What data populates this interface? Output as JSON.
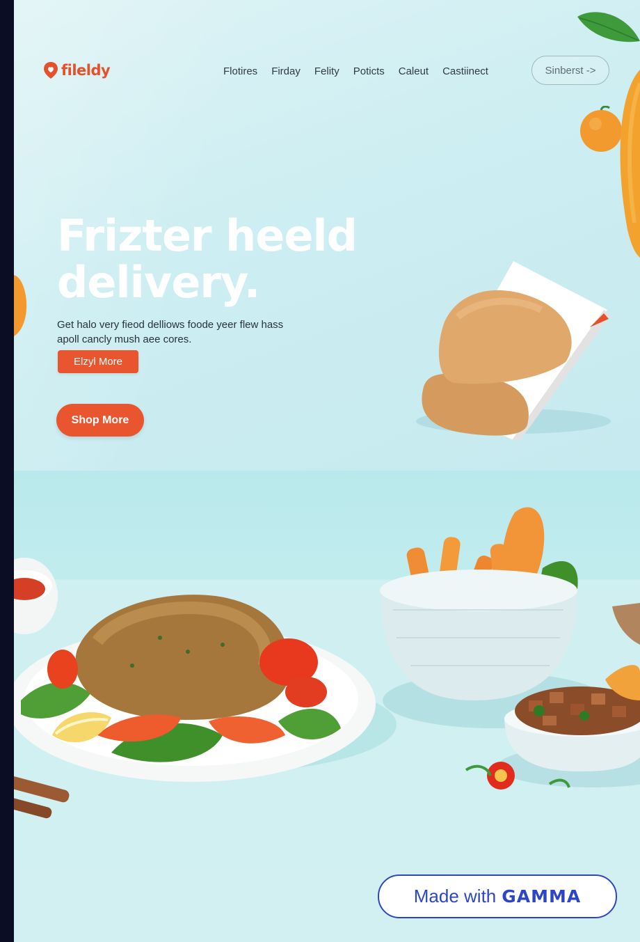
{
  "brand": {
    "name": "fileldy"
  },
  "nav": {
    "items": [
      "Flotires",
      "Firday",
      "Felity",
      "Poticts",
      "Caleut",
      "Castiinect"
    ],
    "signin_label": "Sinberst ->"
  },
  "hero": {
    "title": "Frizter heeld delivery.",
    "subtitle": "Get halo very fieod delliows foode yeer flew hass apoll cancly mush aee cores.",
    "primary_button": "Elzyl More",
    "shop_button": "Shop More"
  },
  "badge": {
    "prefix": "Made with",
    "brand": "GAMMA"
  },
  "colors": {
    "accent": "#e8552f",
    "background": "#cfeef2",
    "badge": "#2d46c8"
  }
}
